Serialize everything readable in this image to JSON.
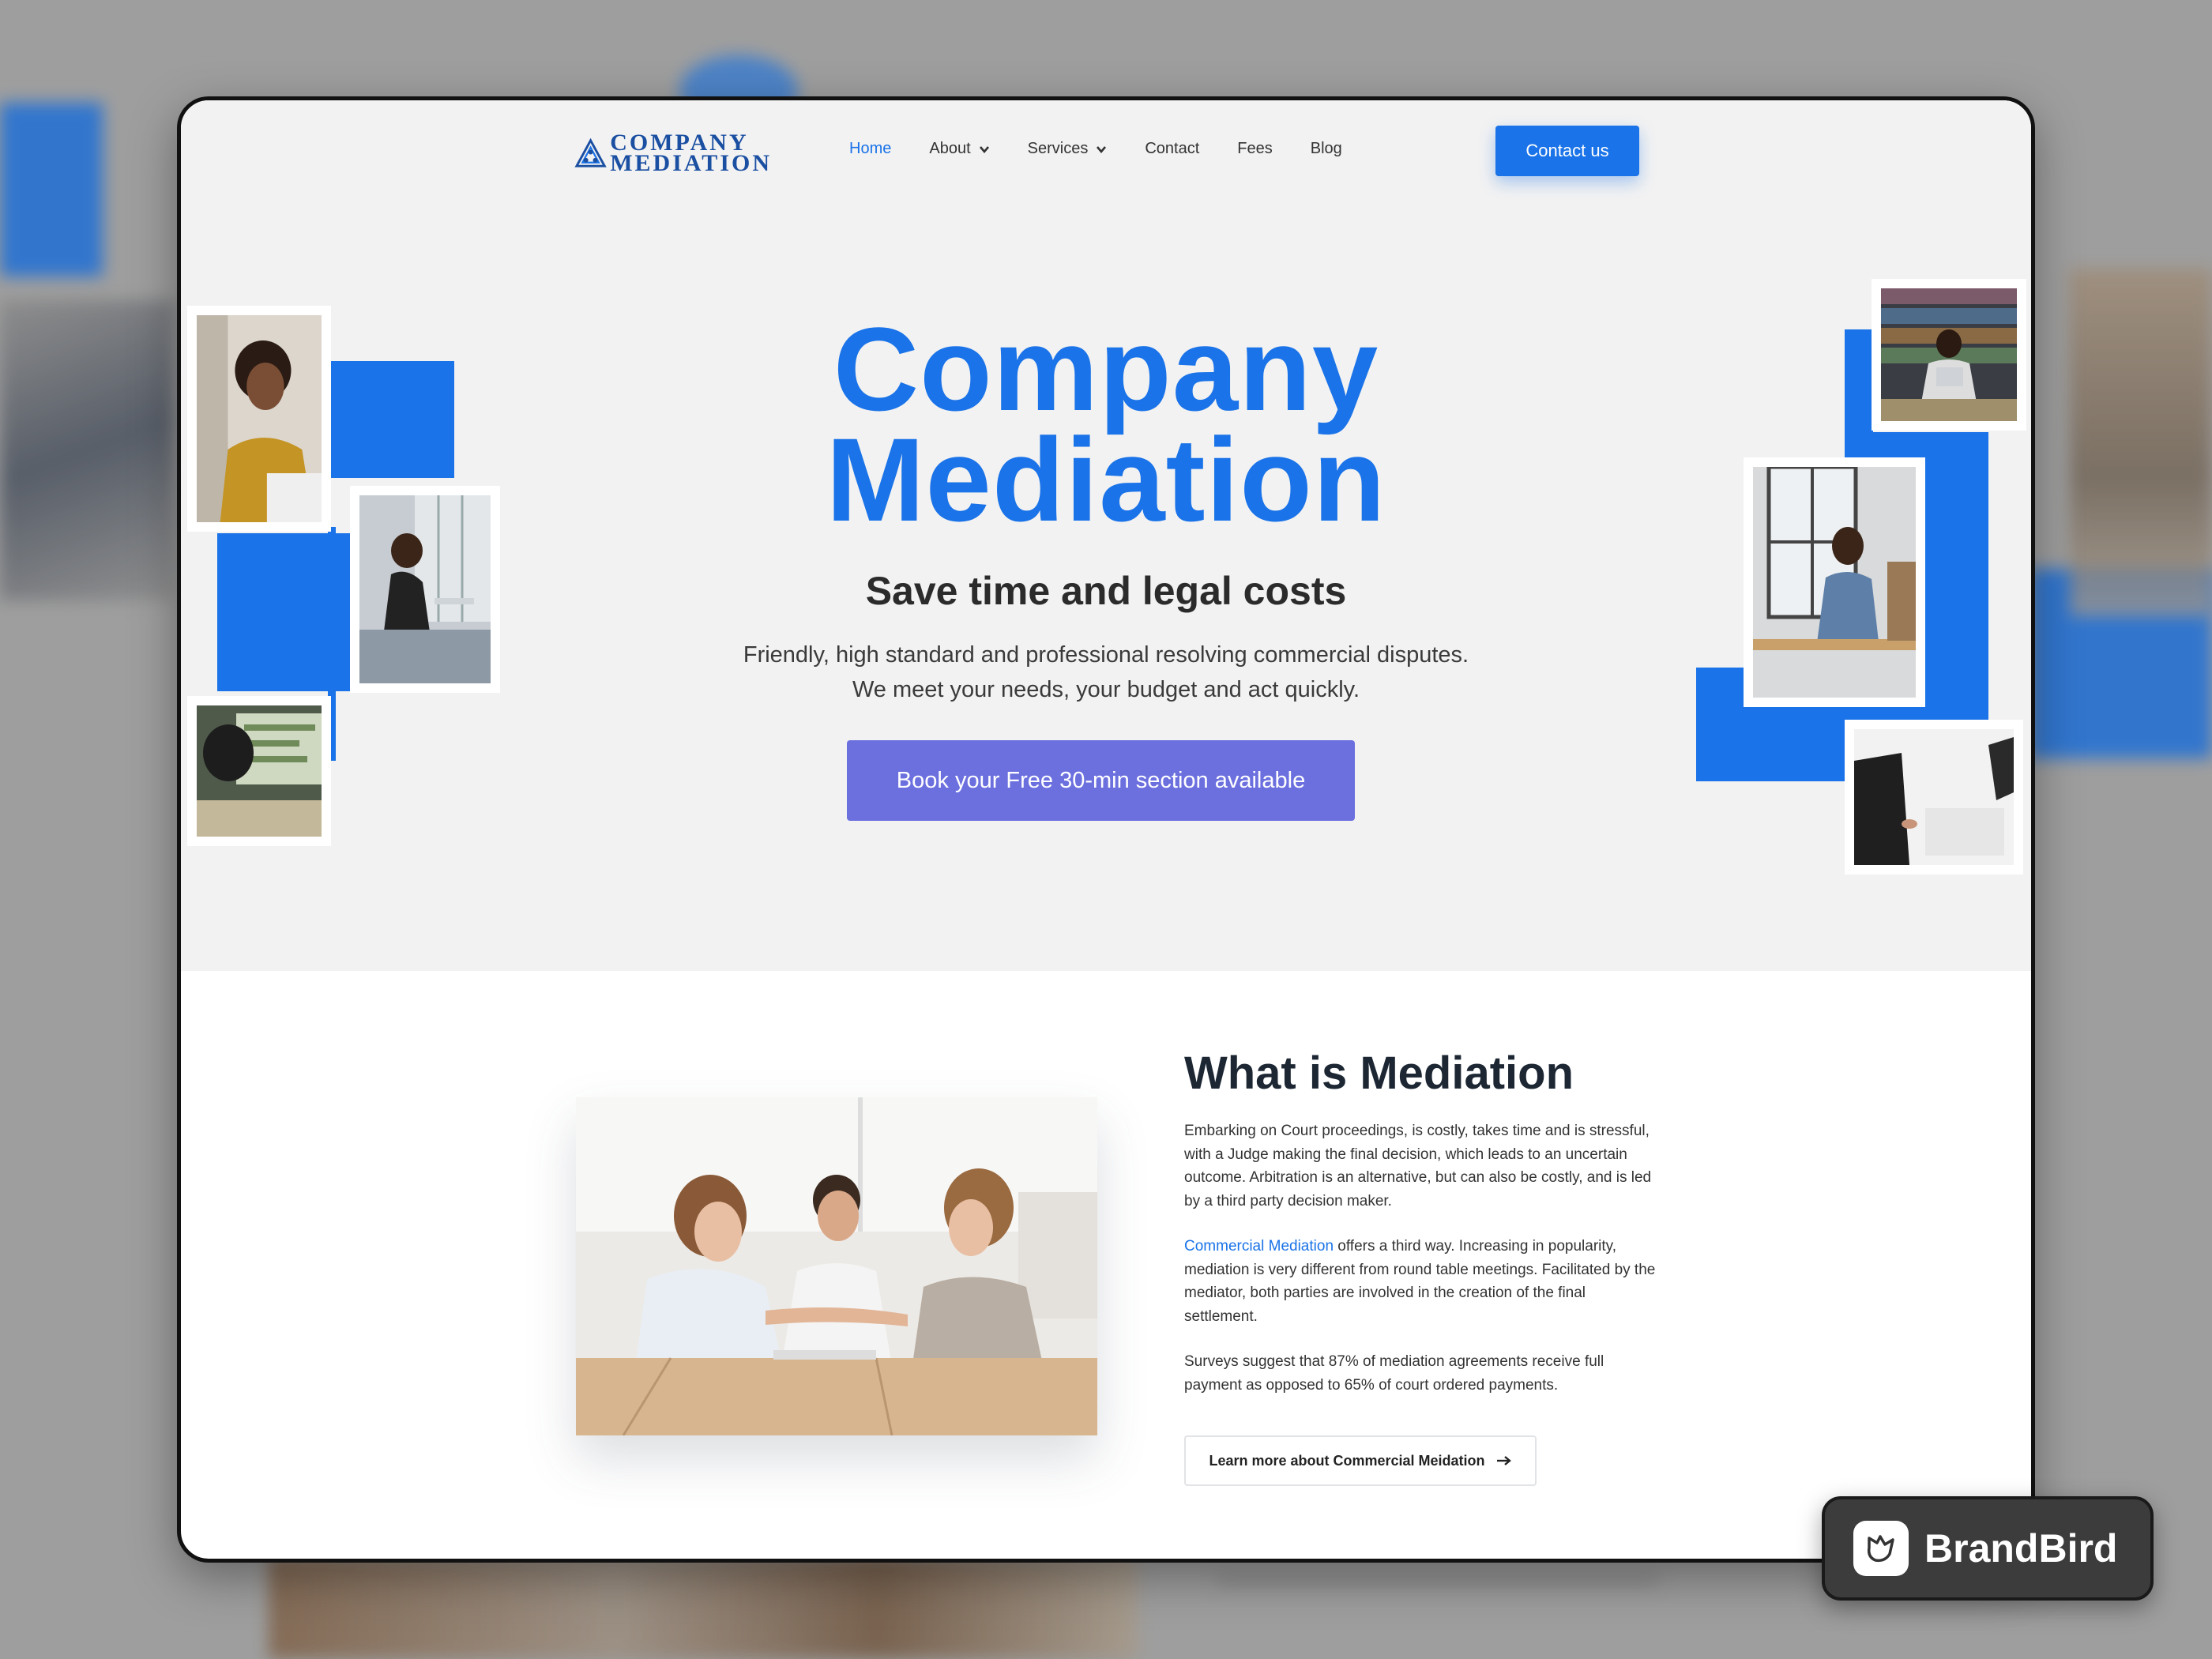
{
  "logo": {
    "line1": "COMPANY",
    "line2": "MEDIATION"
  },
  "nav": {
    "items": [
      {
        "label": "Home",
        "dropdown": false,
        "active": true
      },
      {
        "label": "About",
        "dropdown": true,
        "active": false
      },
      {
        "label": "Services",
        "dropdown": true,
        "active": false
      },
      {
        "label": "Contact",
        "dropdown": false,
        "active": false
      },
      {
        "label": "Fees",
        "dropdown": false,
        "active": false
      },
      {
        "label": "Blog",
        "dropdown": false,
        "active": false
      }
    ],
    "cta_label": "Contact us"
  },
  "hero": {
    "title_line1": "Company",
    "title_line2": "Mediation",
    "subtitle": "Save time and legal costs",
    "desc_line1": "Friendly, high standard and professional resolving commercial disputes.",
    "desc_line2": "We meet your needs, your budget and act quickly.",
    "cta_label": "Book your Free 30-min section available"
  },
  "about": {
    "title": "What is Mediation",
    "p1": "Embarking on Court proceedings, is costly, takes time and is stressful, with a Judge making the final decision, which leads to an uncertain outcome. Arbitration is an alternative, but can also be costly, and is led by a third party decision maker.",
    "p2_link": "Commercial Mediation",
    "p2_rest": " offers a third way. Increasing in popularity, mediation is very different from round table meetings. Facilitated by the mediator, both parties are involved in the creation of the final settlement.",
    "p3": "Surveys suggest that 87% of mediation agreements receive full payment as opposed to 65% of court ordered payments.",
    "learn_label": "Learn more about Commercial Meidation"
  },
  "badge": {
    "label": "BrandBird"
  },
  "colors": {
    "accent": "#1a73e8",
    "cta_purple": "#6c70df",
    "logo_navy": "#1b4fa2",
    "hero_bg": "#f2f2f2"
  },
  "icons": [
    "chevron-down-icon",
    "arrow-right-icon",
    "logo-triangle-icon",
    "brandbird-icon"
  ]
}
